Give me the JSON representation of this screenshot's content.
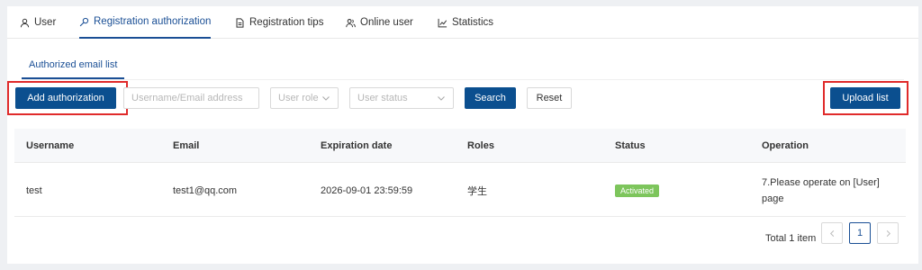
{
  "nav": {
    "tabs": [
      {
        "label": "User",
        "icon": "user-icon"
      },
      {
        "label": "Registration authorization",
        "icon": "key-icon"
      },
      {
        "label": "Registration tips",
        "icon": "document-icon"
      },
      {
        "label": "Online user",
        "icon": "users-icon"
      },
      {
        "label": "Statistics",
        "icon": "chart-icon"
      }
    ],
    "active": "Registration authorization"
  },
  "subtab": {
    "label": "Authorized email list"
  },
  "toolbar": {
    "add_label": "Add authorization",
    "search_placeholder": "Username/Email address",
    "role_placeholder": "User role",
    "status_placeholder": "User status",
    "search_label": "Search",
    "reset_label": "Reset",
    "upload_label": "Upload list"
  },
  "table": {
    "headers": [
      "Username",
      "Email",
      "Expiration date",
      "Roles",
      "Status",
      "Operation"
    ],
    "rows": [
      {
        "username": "test",
        "email": "test1@qq.com",
        "expiration": "2026-09-01 23:59:59",
        "roles": "学生",
        "status": "Activated",
        "operation": "7.Please operate on [User] page"
      }
    ]
  },
  "pagination": {
    "total": "Total 1 item",
    "current": "1"
  },
  "colors": {
    "primary": "#0b4f8f",
    "accent": "#1a4f95",
    "highlight": "#e02b2b",
    "status_active": "#7dc55c"
  }
}
